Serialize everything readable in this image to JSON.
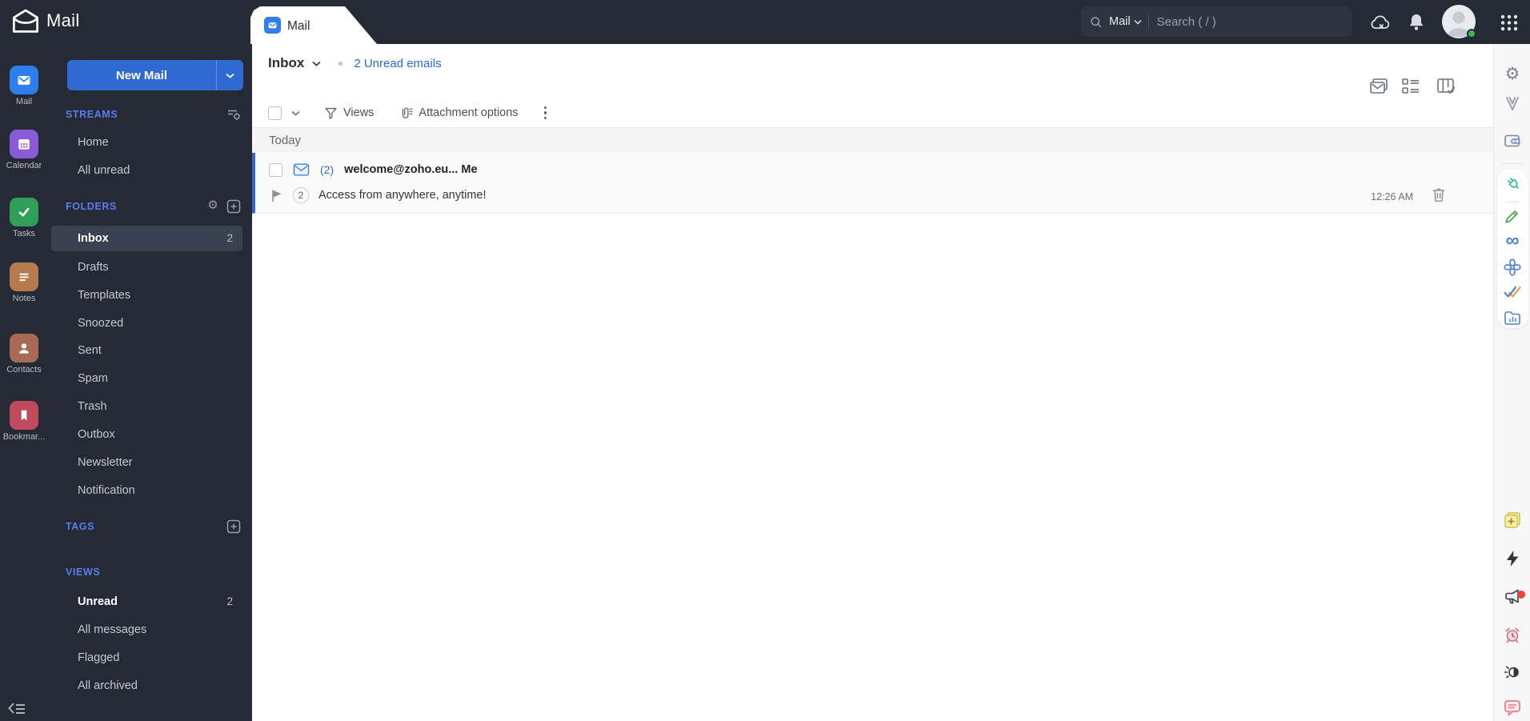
{
  "topbar": {
    "app_title": "Mail",
    "search": {
      "scope": "Mail",
      "placeholder": "Search ( / )"
    }
  },
  "left_rail": {
    "items": [
      {
        "label": "Mail"
      },
      {
        "label": "Calendar"
      },
      {
        "label": "Tasks"
      },
      {
        "label": "Notes"
      },
      {
        "label": "Contacts"
      },
      {
        "label": "Bookmar..."
      }
    ]
  },
  "sidebar": {
    "new_mail_label": "New Mail",
    "streams": {
      "title": "STREAMS",
      "items": [
        {
          "label": "Home"
        },
        {
          "label": "All unread"
        }
      ]
    },
    "folders": {
      "title": "FOLDERS",
      "items": [
        {
          "label": "Inbox",
          "count": "2"
        },
        {
          "label": "Drafts"
        },
        {
          "label": "Templates"
        },
        {
          "label": "Snoozed"
        },
        {
          "label": "Sent"
        },
        {
          "label": "Spam"
        },
        {
          "label": "Trash"
        },
        {
          "label": "Outbox"
        },
        {
          "label": "Newsletter"
        },
        {
          "label": "Notification"
        }
      ]
    },
    "tags": {
      "title": "TAGS"
    },
    "views": {
      "title": "VIEWS",
      "items": [
        {
          "label": "Unread",
          "count": "2"
        },
        {
          "label": "All messages"
        },
        {
          "label": "Flagged"
        },
        {
          "label": "All archived"
        }
      ]
    }
  },
  "main": {
    "tab_label": "Mail",
    "folder_title": "Inbox",
    "unread_link": "2 Unread emails",
    "toolbar": {
      "views_label": "Views",
      "attachment_label": "Attachment options"
    },
    "list": {
      "group_label": "Today",
      "email": {
        "count": "(2)",
        "sender": "welcome@zoho.eu... Me",
        "thread_count": "2",
        "subject": "Access from anywhere, anytime!",
        "time": "12:26 AM"
      }
    }
  },
  "colors": {
    "topbar_bg": "#252a34",
    "accent_blue": "#2e6ad1",
    "link_blue": "#2d68d8",
    "section_header_blue": "#5b7cf0",
    "selected_row_bg": "#3a4150",
    "notification_red": "#e8443f",
    "rail_bg": "#f7f7f8"
  },
  "icons": {
    "gear_glyph": "⚙",
    "infinity_glyph": "∞"
  }
}
